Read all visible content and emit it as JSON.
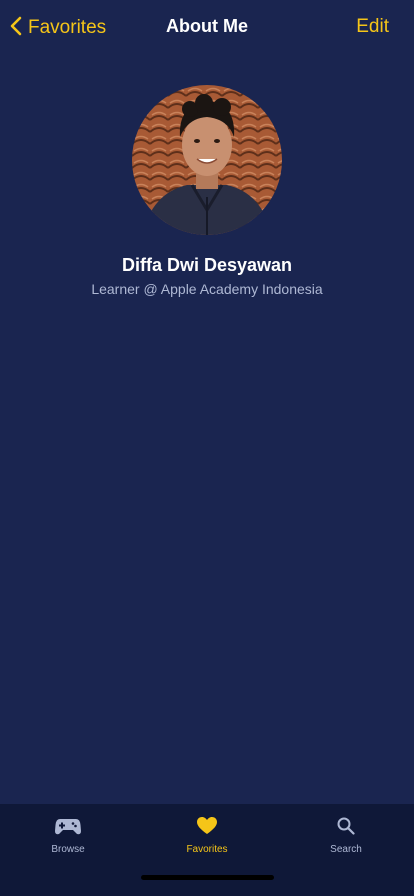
{
  "navbar": {
    "back_label": "Favorites",
    "title": "About Me",
    "edit_label": "Edit"
  },
  "profile": {
    "name": "Diffa Dwi Desyawan",
    "subtitle": "Learner @ Apple Academy Indonesia"
  },
  "tabbar": {
    "items": [
      {
        "label": "Browse",
        "icon": "gamecontroller-icon",
        "active": false
      },
      {
        "label": "Favorites",
        "icon": "heart-icon",
        "active": true
      },
      {
        "label": "Search",
        "icon": "magnifying-glass-icon",
        "active": false
      }
    ]
  },
  "colors": {
    "background": "#1a2550",
    "accent": "#f5c518",
    "tabbar_background": "#0f1838",
    "inactive_tab": "#aeb8d4"
  }
}
